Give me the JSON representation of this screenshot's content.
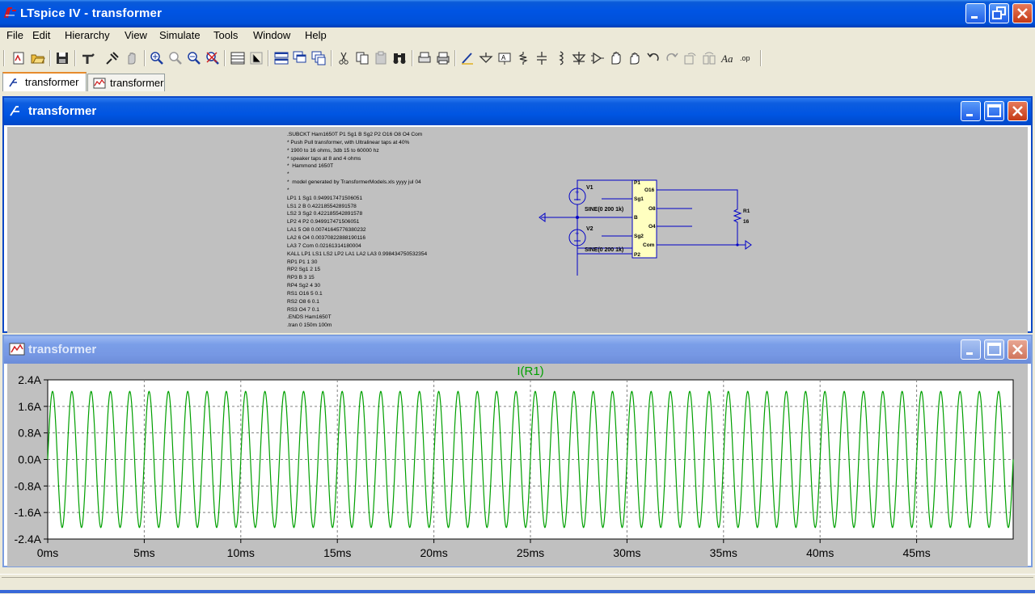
{
  "app": {
    "title": "LTspice IV - transformer",
    "menu": [
      "File",
      "Edit",
      "Hierarchy",
      "View",
      "Simulate",
      "Tools",
      "Window",
      "Help"
    ]
  },
  "tabs": [
    {
      "label": "transformer",
      "kind": "schematic",
      "active": true
    },
    {
      "label": "transformer",
      "kind": "waveform",
      "active": false
    }
  ],
  "toolbar_icons": [
    "new-schematic-icon",
    "open-icon",
    "save-icon",
    "control-panel-icon",
    "run-icon",
    "halt-icon",
    "zoom-in-icon",
    "zoom-out-icon",
    "zoom-fit-icon",
    "zoom-cancel-icon",
    "autorange-icon",
    "axis-icon",
    "tile-horizontal-icon",
    "cascade-icon",
    "tile-icon",
    "cut-icon",
    "copy-icon",
    "paste-icon",
    "find-icon",
    "print-preview-icon",
    "print-icon",
    "wire-icon",
    "ground-icon",
    "label-net-icon",
    "resistor-icon",
    "capacitor-icon",
    "inductor-icon",
    "diode-icon",
    "component-icon",
    "move-icon",
    "drag-icon",
    "undo-icon",
    "redo-icon",
    "rotate-icon",
    "mirror-icon",
    "text-icon",
    "spice-directive-icon"
  ],
  "schematic": {
    "title": "transformer",
    "netlist": [
      ".SUBCKT Ham1650T P1 Sg1 B Sg2 P2 O16 O8 O4 Com",
      "* Push Pull transformer, with Ultralinear taps at 40%",
      "* 1900 to 16 ohms, 3db 15 to 60000 hz",
      "* speaker taps at 8 and 4 ohms",
      "*  Hammond 1650T",
      "*",
      "*  model generated by TransformerModels.xls yyyy jul 04",
      "*",
      "LP1 1 Sg1 0.949917471506051",
      "LS1 2 B 0.422185542891578",
      "LS2 3 Sg2 0.422185542891578",
      "LP2 4 P2 0.949917471506051",
      "LA1 5 O8 0.00741645776380232",
      "LA2 6 O4 0.00370822888190116",
      "LA3 7 Com 0.02161314180004",
      "KALL LP1 LS1 LS2 LP2 LA1 LA2 LA3 0.998434750532354",
      "RP1 P1 1 30",
      "RP2 Sg1 2 15",
      "RP3 B 3 15",
      "RP4 Sg2 4 30",
      "RS1 O16 5 0.1",
      "RS2 O8 6 0.1",
      "RS3 O4 7 0.1",
      ".ENDS Ham1650T",
      ".tran 0 150m 100m"
    ],
    "components": {
      "v1": {
        "name": "V1",
        "value": "SINE(0 200 1k)"
      },
      "v2": {
        "name": "V2",
        "value": "SINE(0 200 1k)"
      },
      "r1": {
        "name": "R1",
        "value": "16"
      },
      "pins_left": [
        "P1",
        "Sg1",
        "B",
        "Sg2",
        "P2"
      ],
      "pins_right": [
        "O16",
        "O8",
        "O4",
        "Com"
      ]
    }
  },
  "waveform": {
    "title": "transformer",
    "chart_data": {
      "type": "line",
      "title": "I(R1)",
      "series": [
        {
          "name": "I(R1)",
          "color": "#00a000",
          "amplitude": 2.05,
          "frequency_hz": 1000
        }
      ],
      "x_ticks": [
        "0ms",
        "5ms",
        "10ms",
        "15ms",
        "20ms",
        "25ms",
        "30ms",
        "35ms",
        "40ms",
        "45ms"
      ],
      "y_ticks": [
        "2.4A",
        "1.6A",
        "0.8A",
        "0.0A",
        "-0.8A",
        "-1.6A",
        "-2.4A"
      ],
      "xlim_ms": [
        0,
        50
      ],
      "ylim": [
        -2.4,
        2.4
      ],
      "grid": true
    }
  }
}
